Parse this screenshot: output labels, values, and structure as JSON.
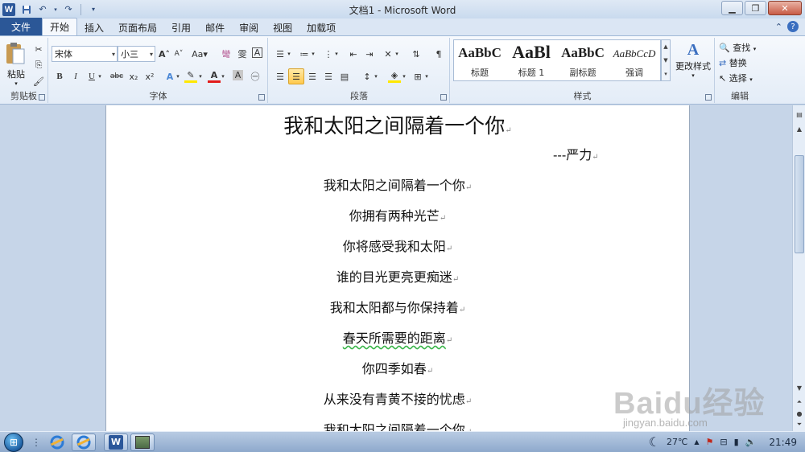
{
  "window": {
    "app_icon": "W",
    "title": "文档1 - Microsoft Word",
    "qat_icons": [
      "save-icon",
      "undo-icon",
      "redo-icon",
      "customize-icon"
    ],
    "controls": [
      "minimize-icon",
      "restore-icon",
      "close-icon"
    ]
  },
  "tabs": {
    "file": "文件",
    "items": [
      "开始",
      "插入",
      "页面布局",
      "引用",
      "邮件",
      "审阅",
      "视图",
      "加载项"
    ],
    "active": "开始"
  },
  "ribbon": {
    "clipboard": {
      "paste": "粘贴",
      "label": "剪贴板"
    },
    "font": {
      "name": "宋体",
      "size": "小三",
      "label": "字体",
      "grow": "A",
      "shrink": "A",
      "case": "Aa",
      "bold": "B",
      "italic": "I",
      "underline": "U",
      "strike": "abc",
      "sub": "x₂",
      "sup": "x²",
      "font_color": "A",
      "char_shade": "A",
      "phonetic": "雯",
      "border_char": "A",
      "clear": "彎"
    },
    "paragraph": {
      "label": "段落"
    },
    "styles": {
      "label": "样式",
      "items": [
        {
          "preview": "AaBbC",
          "name": "标题"
        },
        {
          "preview": "AaBl",
          "name": "标题 1"
        },
        {
          "preview": "AaBbC",
          "name": "副标题"
        },
        {
          "preview": "AaBbCcD",
          "name": "强调"
        }
      ],
      "change": "更改样式"
    },
    "editing": {
      "label": "编辑",
      "find": "查找",
      "replace": "替换",
      "select": "选择"
    }
  },
  "document": {
    "title": "我和太阳之间隔着一个你",
    "author": "---严力",
    "lines": [
      "我和太阳之间隔着一个你",
      "你拥有两种光芒",
      "你将感受我和太阳",
      "谁的目光更亮更痴迷",
      "我和太阳都与你保持着",
      "春天所需要的距离",
      "你四季如春",
      "从来没有青黄不接的忧虑",
      "我和太阳之间隔着一个你"
    ],
    "paragraph_mark": "↵"
  },
  "watermark": {
    "brand": "Baidu经验",
    "url": "jingyan.baidu.com"
  },
  "taskbar": {
    "items": [
      "start-icon",
      "ie-icon",
      "ie-icon",
      "word-icon",
      "image-icon"
    ],
    "weather": "27℃",
    "time": "21:49"
  }
}
